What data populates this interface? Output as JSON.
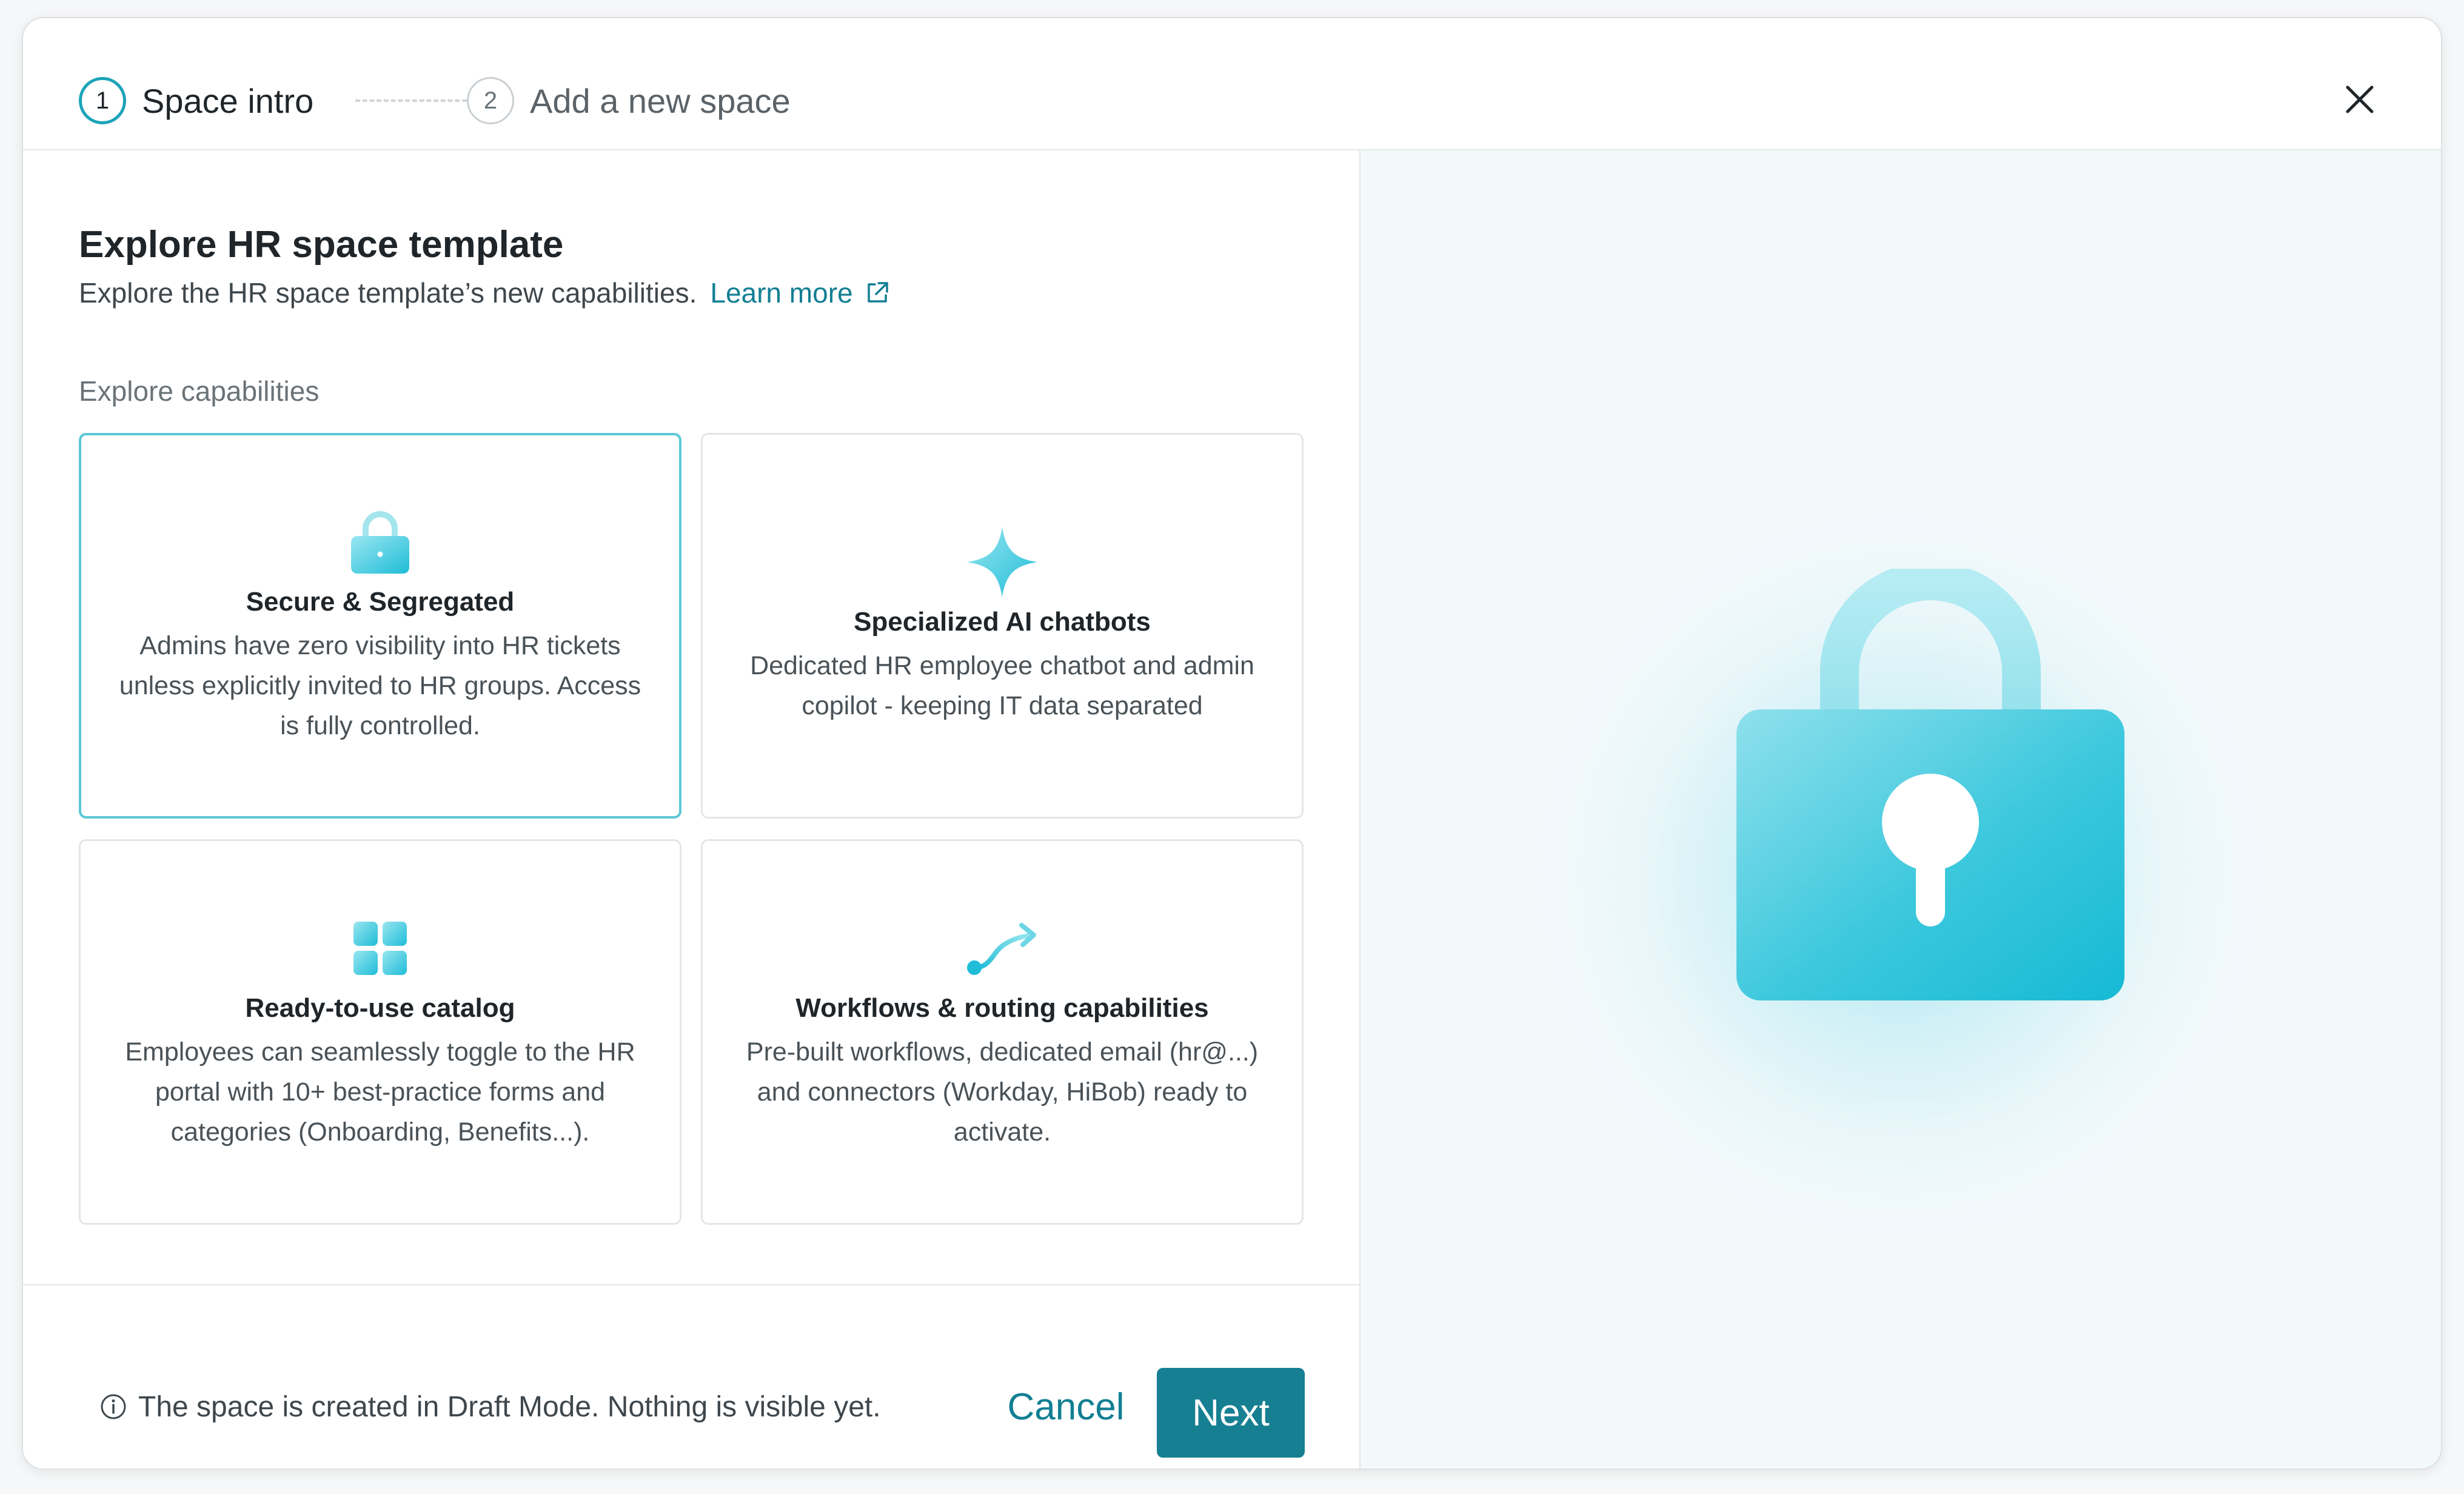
{
  "stepper": {
    "steps": [
      {
        "number": "1",
        "label": "Space intro"
      },
      {
        "number": "2",
        "label": "Add a new space"
      }
    ]
  },
  "content": {
    "title": "Explore HR space template",
    "subtitle": "Explore the HR space template’s new capabilities.",
    "learn_more": "Learn more",
    "section_label": "Explore capabilities",
    "cards": [
      {
        "icon": "lock-icon",
        "title": "Secure & Segregated",
        "description": "Admins have zero visibility into HR tickets unless explicitly invited to HR groups. Access is fully controlled.",
        "selected": true
      },
      {
        "icon": "sparkle-icon",
        "title": "Specialized AI chatbots",
        "description": "Dedicated HR employee chatbot and admin copilot - keeping IT data separated",
        "selected": false
      },
      {
        "icon": "grid-icon",
        "title": "Ready-to-use catalog",
        "description": "Employees can seamlessly toggle to the HR portal with 10+ best-practice forms and categories (Onboarding, Benefits...).",
        "selected": false
      },
      {
        "icon": "route-arrow-icon",
        "title": "Workflows & routing capabilities",
        "description": "Pre-built workflows, dedicated email (hr@...) and connectors (Workday, HiBob) ready to activate.",
        "selected": false
      }
    ]
  },
  "footer": {
    "note": "The space is created in Draft Mode. Nothing is visible yet.",
    "cancel_label": "Cancel",
    "next_label": "Next"
  },
  "colors": {
    "accent": "#167f92",
    "selected_border": "#5cc7d5",
    "icon_gradient_start": "#8ee3ee",
    "icon_gradient_end": "#1fbdd8"
  }
}
